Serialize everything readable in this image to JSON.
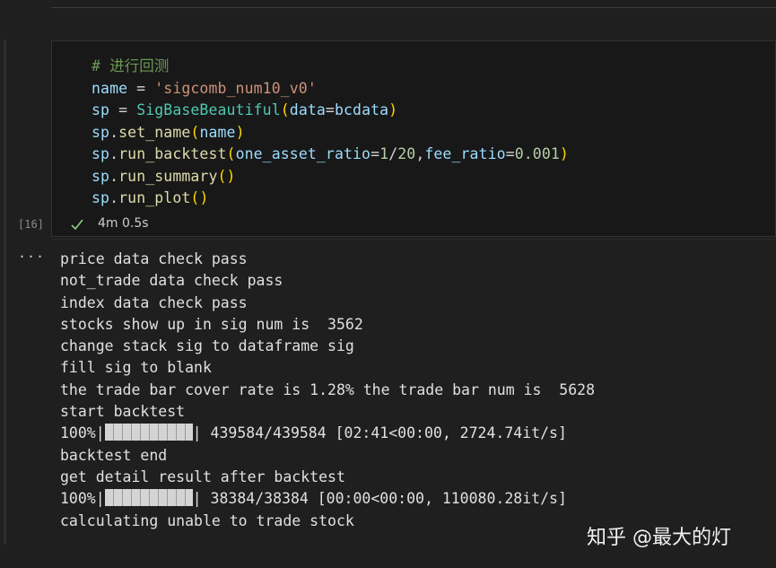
{
  "cell": {
    "code_lines": [
      [
        {
          "t": "# 进行回测",
          "c": "comment"
        }
      ],
      [
        {
          "t": "name",
          "c": "var"
        },
        {
          "t": " = ",
          "c": "op"
        },
        {
          "t": "'sigcomb_num10_v0'",
          "c": "str"
        }
      ],
      [
        {
          "t": "sp",
          "c": "var"
        },
        {
          "t": " = ",
          "c": "op"
        },
        {
          "t": "SigBaseBeautiful",
          "c": "cls"
        },
        {
          "t": "(",
          "c": "p1"
        },
        {
          "t": "data",
          "c": "var"
        },
        {
          "t": "=",
          "c": "op"
        },
        {
          "t": "bcdata",
          "c": "var"
        },
        {
          "t": ")",
          "c": "p1"
        }
      ],
      [
        {
          "t": "sp",
          "c": "var"
        },
        {
          "t": ".",
          "c": "op"
        },
        {
          "t": "set_name",
          "c": "fn"
        },
        {
          "t": "(",
          "c": "p1"
        },
        {
          "t": "name",
          "c": "var"
        },
        {
          "t": ")",
          "c": "p1"
        }
      ],
      [
        {
          "t": "sp",
          "c": "var"
        },
        {
          "t": ".",
          "c": "op"
        },
        {
          "t": "run_backtest",
          "c": "fn"
        },
        {
          "t": "(",
          "c": "p1"
        },
        {
          "t": "one_asset_ratio",
          "c": "var"
        },
        {
          "t": "=",
          "c": "op"
        },
        {
          "t": "1",
          "c": "num"
        },
        {
          "t": "/",
          "c": "op"
        },
        {
          "t": "20",
          "c": "num"
        },
        {
          "t": ",",
          "c": "op"
        },
        {
          "t": "fee_ratio",
          "c": "var"
        },
        {
          "t": "=",
          "c": "op"
        },
        {
          "t": "0.001",
          "c": "num"
        },
        {
          "t": ")",
          "c": "p1"
        }
      ],
      [
        {
          "t": "sp",
          "c": "var"
        },
        {
          "t": ".",
          "c": "op"
        },
        {
          "t": "run_summary",
          "c": "fn"
        },
        {
          "t": "()",
          "c": "p1"
        }
      ],
      [
        {
          "t": "sp",
          "c": "var"
        },
        {
          "t": ".",
          "c": "op"
        },
        {
          "t": "run_plot",
          "c": "fn"
        },
        {
          "t": "()",
          "c": "p1"
        }
      ]
    ],
    "execution_count": "[16]",
    "status_icon": "check-icon",
    "duration": "4m 0.5s"
  },
  "output": {
    "more_label": "···",
    "lines": [
      {
        "text": "price data check pass"
      },
      {
        "text": "not_trade data check pass"
      },
      {
        "text": "index data check pass"
      },
      {
        "text": "stocks show up in sig num is  3562"
      },
      {
        "text": "change stack sig to dataframe sig"
      },
      {
        "text": "fill sig to blank"
      },
      {
        "text": "the trade bar cover rate is 1.28% the trade bar num is  5628"
      },
      {
        "text": "start backtest"
      },
      {
        "progress": 1.0,
        "prefix": "100%|",
        "suffix": "| 439584/439584 [02:41<00:00, 2724.74it/s]"
      },
      {
        "text": "backtest end"
      },
      {
        "text": "get detail result after backtest"
      },
      {
        "progress": 1.0,
        "prefix": "100%|",
        "suffix": "| 38384/38384 [00:00<00:00, 110080.28it/s]"
      },
      {
        "text": "calculating unable to trade stock"
      }
    ]
  },
  "watermark": "知乎 @最大的灯",
  "colors": {
    "background": "#1f1f1f",
    "editor_background": "#181818",
    "check": "#89d185"
  }
}
